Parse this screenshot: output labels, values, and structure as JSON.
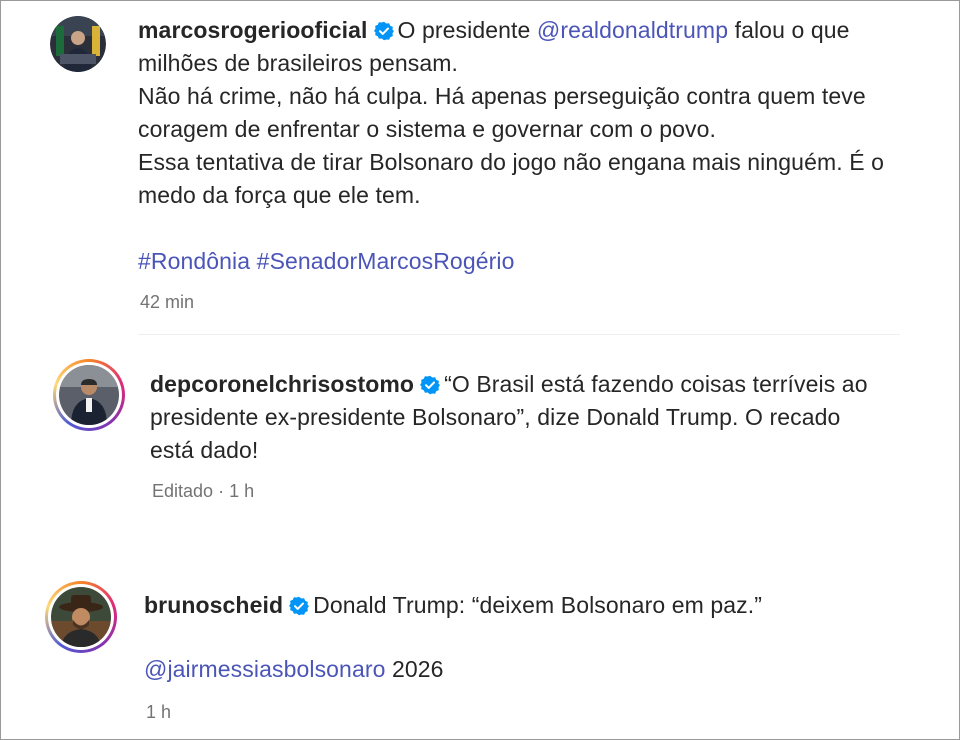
{
  "comments": [
    {
      "username": "marcosrogeriooficial",
      "verified": true,
      "text_before_mention": "O presidente ",
      "mention": "@realdonaldtrump",
      "text_after_mention": " falou o que milhões de brasileiros pensam.",
      "paragraph_2": "Não há crime, não há culpa. Há apenas perseguição contra quem teve coragem de enfrentar o sistema e governar com o povo.",
      "paragraph_3": "Essa tentativa de tirar Bolsonaro do jogo não engana mais ninguém. É o medo da força que ele tem.",
      "hashtag_1": "#Rondônia",
      "hashtag_2": "#SenadorMarcosRogério",
      "time": "42 min"
    },
    {
      "username": "depcoronelchrisostomo",
      "verified": true,
      "text": "“O Brasil está fazendo coisas terríveis ao presidente ex-presidente Bolsonaro”, dize Donald Trump. O recado está dado!",
      "edited_label": "Editado",
      "separator": "·",
      "time": "1 h"
    },
    {
      "username": "brunoscheid",
      "verified": true,
      "text": "Donald Trump: “deixem Bolsonaro em paz.”",
      "mention": "@jairmessiasbolsonaro",
      "mention_suffix": " 2026",
      "time": "1 h"
    }
  ],
  "colors": {
    "link": "#4b55b8",
    "verified": "#0095f6",
    "meta": "#737373",
    "text": "#262626"
  },
  "icons": {
    "verified": "verified-badge-icon"
  }
}
